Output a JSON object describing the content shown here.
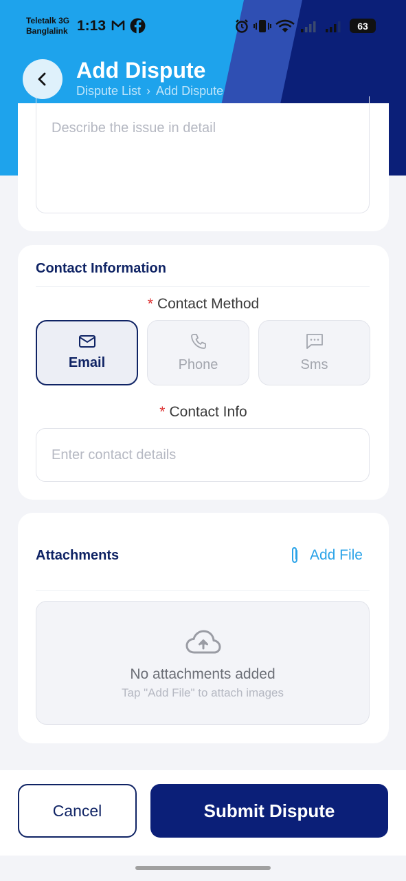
{
  "status_bar": {
    "carrier_1": "Teletalk 3G",
    "carrier_2": "Banglalink",
    "time": "1:13",
    "battery": "63"
  },
  "header": {
    "title": "Add Dispute",
    "breadcrumb": [
      "Dispute List",
      "Add Dispute"
    ],
    "breadcrumb_separator": "›"
  },
  "description": {
    "placeholder": "Describe the issue in detail"
  },
  "contact": {
    "section_title": "Contact Information",
    "method_label": "Contact Method",
    "methods": [
      {
        "label": "Email",
        "icon": "mail-icon",
        "selected": true
      },
      {
        "label": "Phone",
        "icon": "phone-icon",
        "selected": false
      },
      {
        "label": "Sms",
        "icon": "chat-icon",
        "selected": false
      }
    ],
    "info_label": "Contact Info",
    "info_placeholder": "Enter contact details",
    "required_mark": "*"
  },
  "attachments": {
    "section_title": "Attachments",
    "add_file_label": "Add File",
    "empty_title": "No attachments added",
    "empty_subtitle": "Tap \"Add File\" to attach images"
  },
  "footer": {
    "cancel_label": "Cancel",
    "submit_label": "Submit Dispute"
  },
  "colors": {
    "primary": "#0b1f78",
    "accent": "#1ea3ec",
    "link": "#2aa3e8",
    "required": "#d33333"
  }
}
